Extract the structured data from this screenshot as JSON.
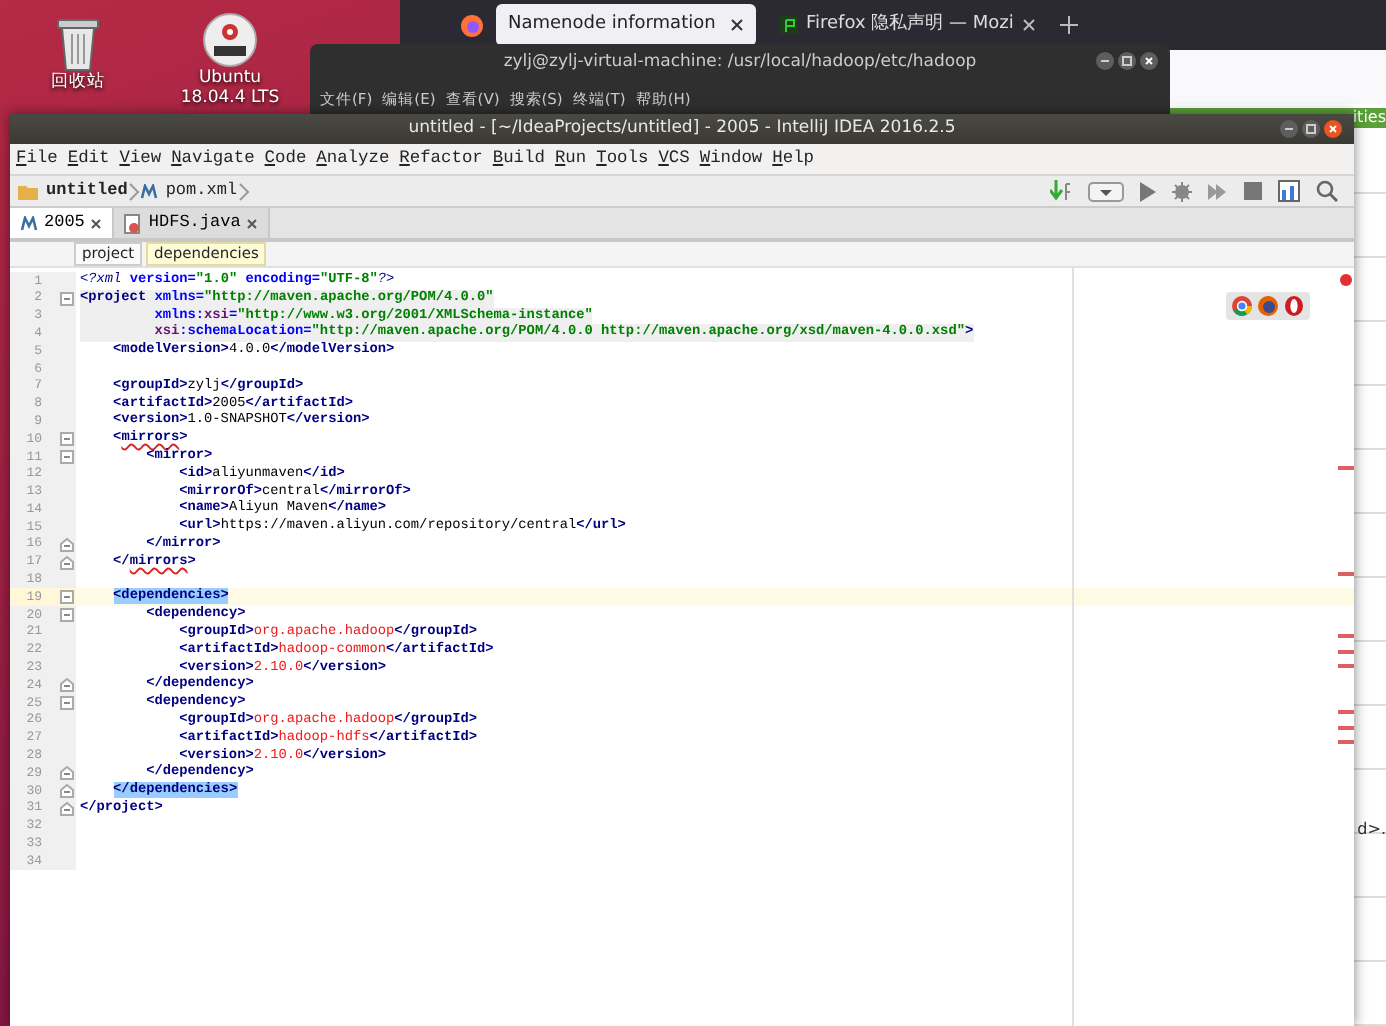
{
  "desktop": {
    "icons": [
      {
        "kind": "trash",
        "label": "回收站"
      },
      {
        "kind": "dvd",
        "label": "Ubuntu\n18.04.4 LTS"
      }
    ]
  },
  "browser": {
    "tabs": [
      {
        "label": "Namenode information",
        "selected": true
      },
      {
        "label": "Firefox 隐私声明 — Mozi",
        "selected": false
      }
    ],
    "banner_text": "ities",
    "page_text": "d>."
  },
  "terminal": {
    "title": "zylj@zylj-virtual-machine: /usr/local/hadoop/etc/hadoop",
    "menu": [
      "文件(F)",
      "编辑(E)",
      "查看(V)",
      "搜索(S)",
      "终端(T)",
      "帮助(H)"
    ]
  },
  "ide": {
    "title": "untitled - [~/IdeaProjects/untitled] - 2005 - IntelliJ IDEA 2016.2.5",
    "menu": [
      "File",
      "Edit",
      "View",
      "Navigate",
      "Code",
      "Analyze",
      "Refactor",
      "Build",
      "Run",
      "Tools",
      "VCS",
      "Window",
      "Help"
    ],
    "nav_path": [
      {
        "kind": "folder",
        "label": "untitled"
      },
      {
        "kind": "maven",
        "label": "pom.xml"
      }
    ],
    "tabs": [
      {
        "kind": "maven",
        "label": "2005",
        "selected": true
      },
      {
        "kind": "java",
        "label": "HDFS.java",
        "selected": false
      }
    ],
    "breadcrumbs": [
      {
        "label": "project",
        "selected": false
      },
      {
        "label": "dependencies",
        "selected": true
      }
    ],
    "lines": [
      {
        "n": "1",
        "tokens": [
          {
            "kind": "pi",
            "t": "<?xml"
          },
          {
            "kind": "attr",
            "t": " version="
          },
          {
            "kind": "str",
            "t": "\"1.0\""
          },
          {
            "kind": "attr",
            "t": " encoding="
          },
          {
            "kind": "str",
            "t": "\"UTF-8\""
          },
          {
            "kind": "pi",
            "t": "?>"
          }
        ]
      },
      {
        "n": "2",
        "fold_start": true,
        "tag_block": true,
        "tokens": [
          {
            "kind": "tag",
            "t": "<project"
          },
          {
            "kind": "attr",
            "t": " xmlns="
          },
          {
            "kind": "str",
            "t": "\"http://maven.apache.org/POM/4.0.0\""
          }
        ]
      },
      {
        "n": "3",
        "tag_block": true,
        "tokens": [
          {
            "kind": "attr",
            "t": "         xmlns:"
          },
          {
            "kind": "ns",
            "t": "xsi"
          },
          {
            "kind": "attr",
            "t": "="
          },
          {
            "kind": "str",
            "t": "\"http://www.w3.org/2001/XMLSchema-instance\""
          }
        ]
      },
      {
        "n": "4",
        "tag_block": true,
        "tokens": [
          {
            "kind": "ns",
            "t": "         xsi"
          },
          {
            "kind": "attr",
            "t": ":schemaLocation="
          },
          {
            "kind": "str",
            "t": "\"http://maven.apache.org/POM/4.0.0 http://maven.apache.org/xsd/maven-4.0.0.xsd\""
          },
          {
            "kind": "tag",
            "t": ">"
          }
        ]
      },
      {
        "n": "5",
        "tokens": [
          {
            "kind": "tag",
            "t": "    <modelVersion>"
          },
          {
            "kind": "text",
            "t": "4.0.0"
          },
          {
            "kind": "tag",
            "t": "</modelVersion>"
          }
        ]
      },
      {
        "n": "6"
      },
      {
        "n": "7",
        "tokens": [
          {
            "kind": "tag",
            "t": "    <groupId>"
          },
          {
            "kind": "text",
            "t": "zylj"
          },
          {
            "kind": "tag",
            "t": "</groupId>"
          }
        ]
      },
      {
        "n": "8",
        "tokens": [
          {
            "kind": "tag",
            "t": "    <artifactId>"
          },
          {
            "kind": "text",
            "t": "2005"
          },
          {
            "kind": "tag",
            "t": "</artifactId>"
          }
        ]
      },
      {
        "n": "9",
        "tokens": [
          {
            "kind": "tag",
            "t": "    <version>"
          },
          {
            "kind": "text",
            "t": "1.0-SNAPSHOT"
          },
          {
            "kind": "tag",
            "t": "</version>"
          }
        ]
      },
      {
        "n": "10",
        "fold_start": true,
        "tokens": [
          {
            "kind": "tag",
            "t": "    <"
          },
          {
            "kind": "tag",
            "t": "mirrors",
            "warn": true
          },
          {
            "kind": "tag",
            "t": ">"
          }
        ]
      },
      {
        "n": "11",
        "fold_start": true,
        "tokens": [
          {
            "kind": "tag",
            "t": "        <mirror>"
          }
        ]
      },
      {
        "n": "12",
        "tokens": [
          {
            "kind": "tag",
            "t": "            <id>"
          },
          {
            "kind": "text",
            "t": "aliyunmaven"
          },
          {
            "kind": "tag",
            "t": "</id>"
          }
        ]
      },
      {
        "n": "13",
        "tokens": [
          {
            "kind": "tag",
            "t": "            <mirrorOf>"
          },
          {
            "kind": "text",
            "t": "central"
          },
          {
            "kind": "tag",
            "t": "</mirrorOf>"
          }
        ]
      },
      {
        "n": "14",
        "tokens": [
          {
            "kind": "tag",
            "t": "            <name>"
          },
          {
            "kind": "text",
            "t": "Aliyun Maven"
          },
          {
            "kind": "tag",
            "t": "</name>"
          }
        ]
      },
      {
        "n": "15",
        "tokens": [
          {
            "kind": "tag",
            "t": "            <url>"
          },
          {
            "kind": "text",
            "t": "https://maven.aliyun.com/repository/central"
          },
          {
            "kind": "tag",
            "t": "</url>"
          }
        ]
      },
      {
        "n": "16",
        "fold_end": true,
        "tokens": [
          {
            "kind": "tag",
            "t": "        </mirror>"
          }
        ]
      },
      {
        "n": "17",
        "fold_end": true,
        "tokens": [
          {
            "kind": "tag",
            "t": "    </"
          },
          {
            "kind": "tag",
            "t": "mirrors",
            "warn": true
          },
          {
            "kind": "tag",
            "t": ">"
          }
        ]
      },
      {
        "n": "18"
      },
      {
        "n": "19",
        "fold_start": true,
        "caret_line": true,
        "tokens": [
          {
            "kind": "tag",
            "t": "    <dependencies>",
            "match": true
          }
        ]
      },
      {
        "n": "20",
        "fold_start": true,
        "tokens": [
          {
            "kind": "tag",
            "t": "        <dependency>"
          }
        ]
      },
      {
        "n": "21",
        "tokens": [
          {
            "kind": "tag",
            "t": "            <groupId>"
          },
          {
            "kind": "error",
            "t": "org.apache.hadoop"
          },
          {
            "kind": "tag",
            "t": "</groupId>"
          }
        ]
      },
      {
        "n": "22",
        "tokens": [
          {
            "kind": "tag",
            "t": "            <artifactId>"
          },
          {
            "kind": "error",
            "t": "hadoop-common"
          },
          {
            "kind": "tag",
            "t": "</artifactId>"
          }
        ]
      },
      {
        "n": "23",
        "tokens": [
          {
            "kind": "tag",
            "t": "            <version>"
          },
          {
            "kind": "error",
            "t": "2.10.0"
          },
          {
            "kind": "tag",
            "t": "</version>"
          }
        ]
      },
      {
        "n": "24",
        "fold_end": true,
        "tokens": [
          {
            "kind": "tag",
            "t": "        </dependency>"
          }
        ]
      },
      {
        "n": "25",
        "fold_start": true,
        "tokens": [
          {
            "kind": "tag",
            "t": "        <dependency>"
          }
        ]
      },
      {
        "n": "26",
        "tokens": [
          {
            "kind": "tag",
            "t": "            <groupId>"
          },
          {
            "kind": "error",
            "t": "org.apache.hadoop"
          },
          {
            "kind": "tag",
            "t": "</groupId>"
          }
        ]
      },
      {
        "n": "27",
        "tokens": [
          {
            "kind": "tag",
            "t": "            <artifactId>"
          },
          {
            "kind": "error",
            "t": "hadoop-hdfs"
          },
          {
            "kind": "tag",
            "t": "</artifactId>"
          }
        ]
      },
      {
        "n": "28",
        "tokens": [
          {
            "kind": "tag",
            "t": "            <version>"
          },
          {
            "kind": "error",
            "t": "2.10.0"
          },
          {
            "kind": "tag",
            "t": "</version>"
          }
        ]
      },
      {
        "n": "29",
        "fold_end": true,
        "tokens": [
          {
            "kind": "tag",
            "t": "        </dependency>"
          }
        ]
      },
      {
        "n": "30",
        "fold_end": true,
        "tokens": [
          {
            "kind": "tag",
            "t": "    </dependencies>",
            "match": true
          }
        ]
      },
      {
        "n": "31",
        "fold_end": true,
        "tokens": [
          {
            "kind": "tag",
            "t": "</project>"
          }
        ]
      },
      {
        "n": "32"
      },
      {
        "n": "33"
      },
      {
        "n": "34"
      }
    ]
  }
}
